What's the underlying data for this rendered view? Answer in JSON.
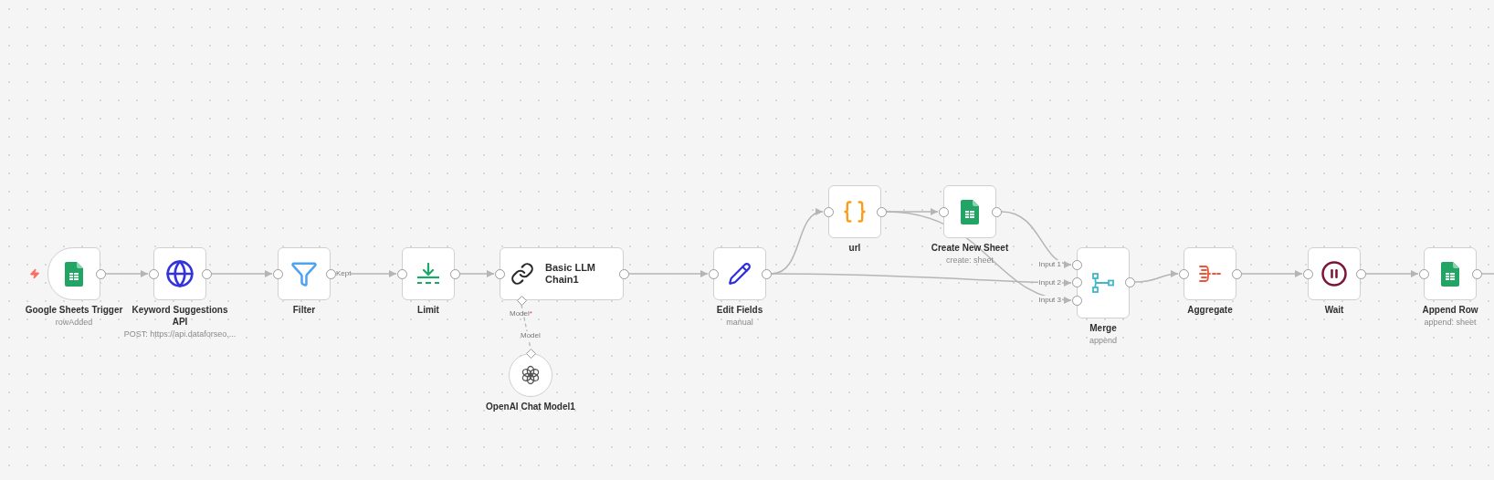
{
  "nodes": [
    {
      "kind": "trigger",
      "title": "Google Sheets Trigger",
      "subtitle": "rowAdded"
    },
    {
      "kind": "action",
      "title": "Keyword Suggestions API",
      "subtitle": "POST: https://api.dataforseo...."
    },
    {
      "kind": "action",
      "title": "Filter",
      "output_label": "Kept"
    },
    {
      "kind": "action",
      "title": "Limit"
    },
    {
      "kind": "wide",
      "title": "Basic LLM Chain1",
      "connector_label": "Model",
      "required_mark": "*"
    },
    {
      "kind": "sub",
      "title": "OpenAI Chat Model1",
      "connector_label": "Model"
    },
    {
      "kind": "action",
      "title": "Edit Fields",
      "subtitle": "manual"
    },
    {
      "kind": "action",
      "title": "url"
    },
    {
      "kind": "action",
      "title": "Create New Sheet",
      "subtitle": "create: sheet"
    },
    {
      "kind": "merge",
      "title": "Merge",
      "subtitle": "append",
      "input_labels": [
        "Input 1",
        "Input 2",
        "Input 3"
      ]
    },
    {
      "kind": "action",
      "title": "Aggregate"
    },
    {
      "kind": "action",
      "title": "Wait"
    },
    {
      "kind": "action",
      "title": "Append Row",
      "subtitle": "append: sheet"
    }
  ]
}
